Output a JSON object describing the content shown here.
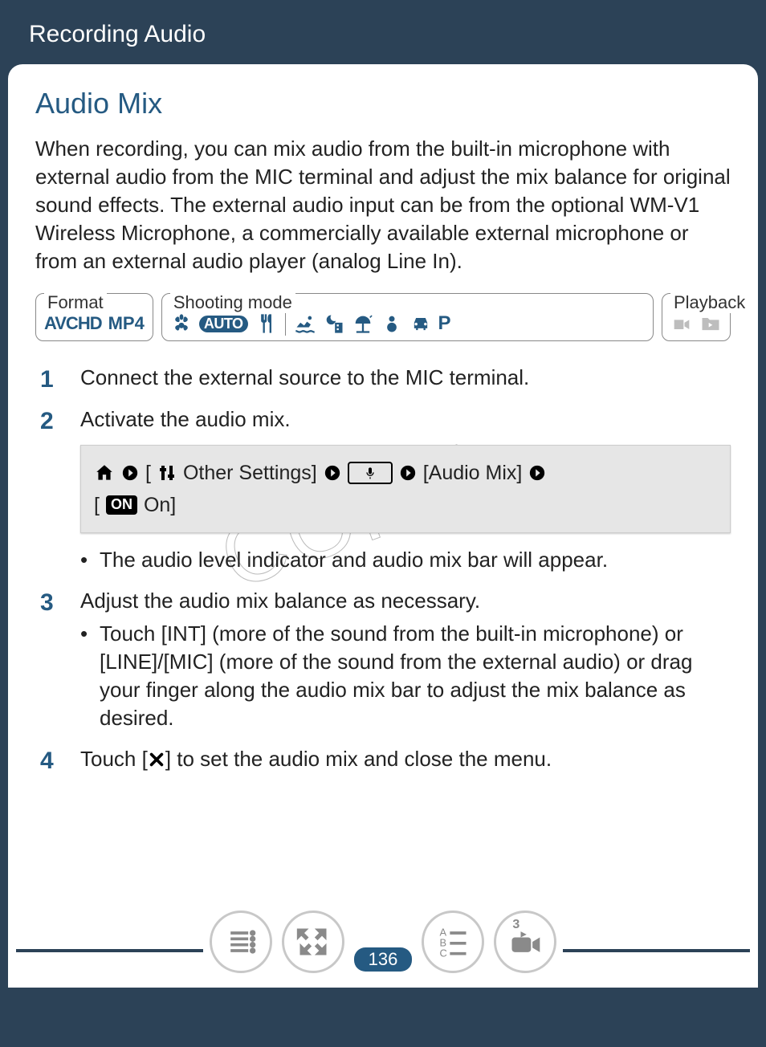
{
  "header": "Recording Audio",
  "title": "Audio Mix",
  "intro": "When recording, you can mix audio from the built-in microphone with external audio from the MIC terminal and adjust the mix balance for original sound effects. The external audio input can be from the optional WM-V1 Wireless Microphone, a commercially available external microphone or from an external audio player (analog Line In).",
  "modes": {
    "format": {
      "label": "Format",
      "items": [
        "AVCHD",
        "MP4"
      ]
    },
    "shooting": {
      "label": "Shooting mode",
      "auto_text": "AUTO",
      "p_text": "P",
      "icons": [
        "flower",
        "auto",
        "cutlery",
        "swimmer",
        "night-building",
        "beach-umbrella",
        "snowman",
        "car",
        "P"
      ]
    },
    "playback": {
      "label": "Playback",
      "icons": [
        "film-camera",
        "play-folder"
      ]
    }
  },
  "steps": {
    "s1": "Connect the external source to the MIC terminal.",
    "s2": "Activate the audio mix.",
    "s2_nav": {
      "other_settings": " Other Settings]",
      "audio_mix": "[Audio Mix]",
      "on": "On]",
      "bracket_open": "[",
      "bracket_open2": "["
    },
    "s2_bullet": "The audio level indicator and audio mix bar will appear.",
    "s3": "Adjust the audio mix balance as necessary.",
    "s3_bullet": "Touch [INT] (more of the sound from the built-in microphone) or [LINE]/[MIC] (more of the sound from the external audio) or drag your finger along the audio mix bar to adjust the mix balance as desired.",
    "s4_a": "Touch [",
    "s4_b": "] to set the audio mix and close the menu."
  },
  "watermark": "COPY",
  "page_number": "136",
  "footer_badge": "3",
  "on_label": "ON"
}
